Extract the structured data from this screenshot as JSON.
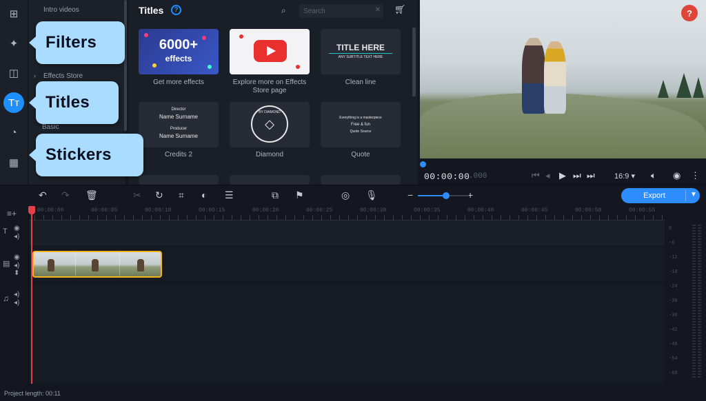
{
  "sidebar": {
    "items": [
      {
        "label": "Intro videos"
      },
      {
        "label": "Effects Store"
      },
      {
        "label": "Basic"
      }
    ]
  },
  "rail": {
    "icons": [
      "import-icon",
      "magic-wand-icon",
      "transition-icon",
      "titles-icon",
      "sticker-icon",
      "grid-icon"
    ]
  },
  "callouts": {
    "filters": "Filters",
    "titles": "Titles",
    "stickers": "Stickers"
  },
  "panel": {
    "title": "Titles",
    "help": "?",
    "search_placeholder": "Search",
    "tiles": [
      {
        "label": "Get more effects",
        "big": "6000+",
        "small": "effects"
      },
      {
        "label": "Explore more on Effects Store page"
      },
      {
        "label": "Clean line",
        "line1": "TITLE HERE",
        "line2": "ANY SUBTITLE TEXT HERE"
      },
      {
        "label": "Credits 2",
        "line1": "Director",
        "line2": "Name Surname",
        "line3": "Producer",
        "line4": "Name Surname"
      },
      {
        "label": "Diamond",
        "line1": "BY DIAMOND"
      },
      {
        "label": "Quote",
        "line1": "Everything is a masterpiece",
        "line2": "Free & fun",
        "line3": "Quote Source"
      }
    ]
  },
  "preview": {
    "alert": "?",
    "timecode": "00:00:00",
    "timecode_frac": ".000",
    "aspect": "16:9 ▾"
  },
  "toolbar": {
    "export_label": "Export"
  },
  "ruler": {
    "labels": [
      "00:00:00",
      "00:00:05",
      "00:00:10",
      "00:00:15",
      "00:00:20",
      "00:00:25",
      "00:00:30",
      "00:00:35",
      "00:00:40",
      "00:00:45",
      "00:00:50",
      "00:00:55"
    ]
  },
  "meter": {
    "labels": [
      "0",
      "-6",
      "-12",
      "-18",
      "-24",
      "-30",
      "-36",
      "-42",
      "-48",
      "-54",
      "-60"
    ]
  },
  "status": {
    "project_length": "Project length: 00:11"
  },
  "colors": {
    "accent": "#2d8cff",
    "callout": "#a9dcff",
    "playhead": "#e3404a",
    "clip_border": "#f2b31f"
  }
}
